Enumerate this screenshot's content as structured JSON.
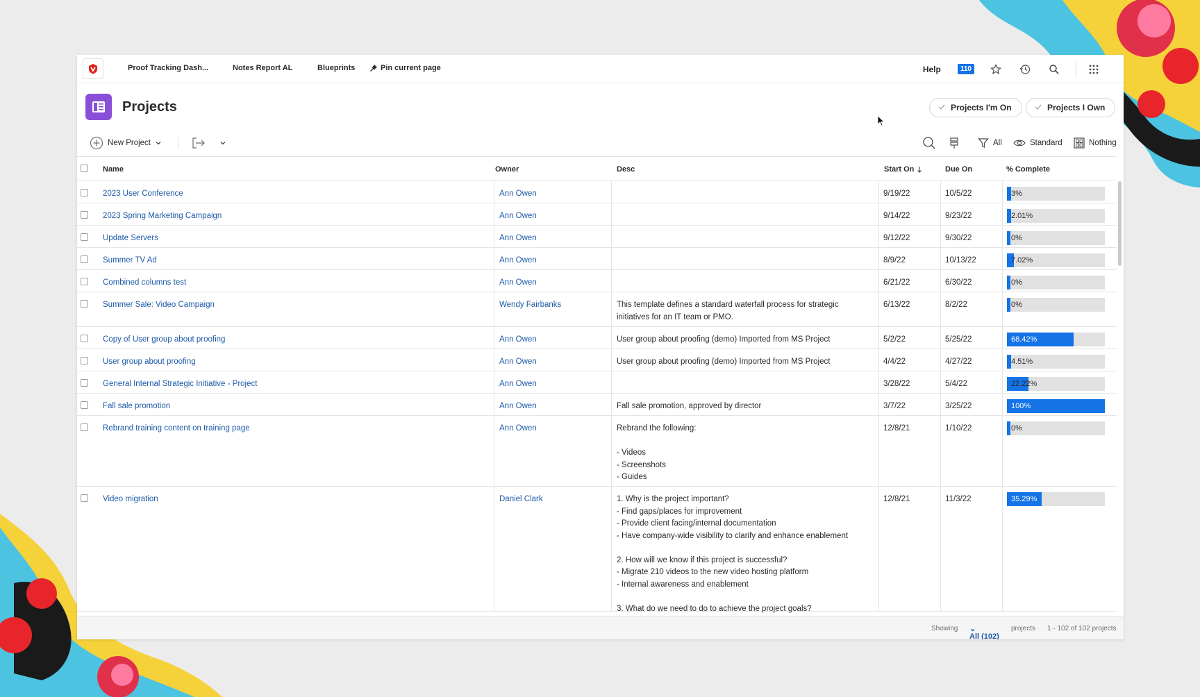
{
  "nav": {
    "items": [
      "Proof Tracking Dash...",
      "Notes Report AL",
      "Blueprints",
      "Pin current page"
    ],
    "help": "Help",
    "badge": "110",
    "icons": [
      "star-icon",
      "history-icon",
      "search-icon",
      "app-grid-icon"
    ]
  },
  "header": {
    "title": "Projects",
    "pill_on": "Projects I'm On",
    "pill_own": "Projects I Own"
  },
  "toolbar": {
    "new_project": "New Project",
    "filter": "All",
    "view": "Standard",
    "group": "Nothing"
  },
  "table": {
    "columns": [
      "Name",
      "Owner",
      "Desc",
      "Start On",
      "Due On",
      "% Complete"
    ],
    "sorted_column": "Start On",
    "sort_direction": "descending",
    "rows": [
      {
        "name": "2023 User Conference",
        "owner": "Ann Owen",
        "desc": "",
        "start": "9/19/22",
        "due": "10/5/22",
        "pct_label": "3%",
        "pct": 3
      },
      {
        "name": "2023 Spring Marketing Campaign",
        "owner": "Ann Owen",
        "desc": "",
        "start": "9/14/22",
        "due": "9/23/22",
        "pct_label": "2.01%",
        "pct": 2.01
      },
      {
        "name": "Update Servers",
        "owner": "Ann Owen",
        "desc": "",
        "start": "9/12/22",
        "due": "9/30/22",
        "pct_label": "0%",
        "pct": 0
      },
      {
        "name": "Summer TV Ad",
        "owner": "Ann Owen",
        "desc": "",
        "start": "8/9/22",
        "due": "10/13/22",
        "pct_label": "7.02%",
        "pct": 7.02
      },
      {
        "name": "Combined columns test",
        "owner": "Ann Owen",
        "desc": "",
        "start": "6/21/22",
        "due": "6/30/22",
        "pct_label": "0%",
        "pct": 0
      },
      {
        "name": "Summer Sale: Video Campaign",
        "owner": "Wendy Fairbanks",
        "desc": "This template defines a standard waterfall process for strategic initiatives for an IT team or PMO.",
        "start": "6/13/22",
        "due": "8/2/22",
        "pct_label": "0%",
        "pct": 0
      },
      {
        "name": "Copy of User group about proofing",
        "owner": "Ann Owen",
        "desc": "User group about proofing (demo) Imported from MS Project",
        "start": "5/2/22",
        "due": "5/25/22",
        "pct_label": "68.42%",
        "pct": 68.42
      },
      {
        "name": "User group about proofing",
        "owner": "Ann Owen",
        "desc": "User group about proofing (demo) Imported from MS Project",
        "start": "4/4/22",
        "due": "4/27/22",
        "pct_label": "4.51%",
        "pct": 4.51
      },
      {
        "name": "General Internal Strategic Initiative - Project",
        "owner": "Ann Owen",
        "desc": "",
        "start": "3/28/22",
        "due": "5/4/22",
        "pct_label": "22.22%",
        "pct": 22.22
      },
      {
        "name": "Fall sale promotion",
        "owner": "Ann Owen",
        "desc": "Fall sale promotion, approved by director",
        "start": "3/7/22",
        "due": "3/25/22",
        "pct_label": "100%",
        "pct": 100
      },
      {
        "name": "Rebrand training content on training page",
        "owner": "Ann Owen",
        "desc": "Rebrand the following:\n\n- Videos\n- Screenshots\n- Guides",
        "start": "12/8/21",
        "due": "1/10/22",
        "pct_label": "0%",
        "pct": 0
      },
      {
        "name": "Video migration",
        "owner": "Daniel Clark",
        "desc": "1. Why is the project important?\n- Find gaps/places for improvement\n- Provide client facing/internal documentation\n- Have company-wide visibility to clarify and enhance enablement\n\n2. How will we know if this project is successful?\n- Migrate 210 videos to the new video hosting platform\n- Internal awareness and enablement\n\n3. What do we need to do to achieve the project goals?",
        "start": "12/8/21",
        "due": "11/3/22",
        "pct_label": "35.29%",
        "pct": 35.29
      }
    ]
  },
  "footer": {
    "showing": "Showing",
    "all": "All (102)",
    "projects": "projects",
    "range": "1 - 102 of 102 projects"
  },
  "colors": {
    "accent": "#1473e6",
    "link": "#1d5aa8",
    "projects_icon": "#8a4fd8",
    "logo": "#e0201b"
  }
}
